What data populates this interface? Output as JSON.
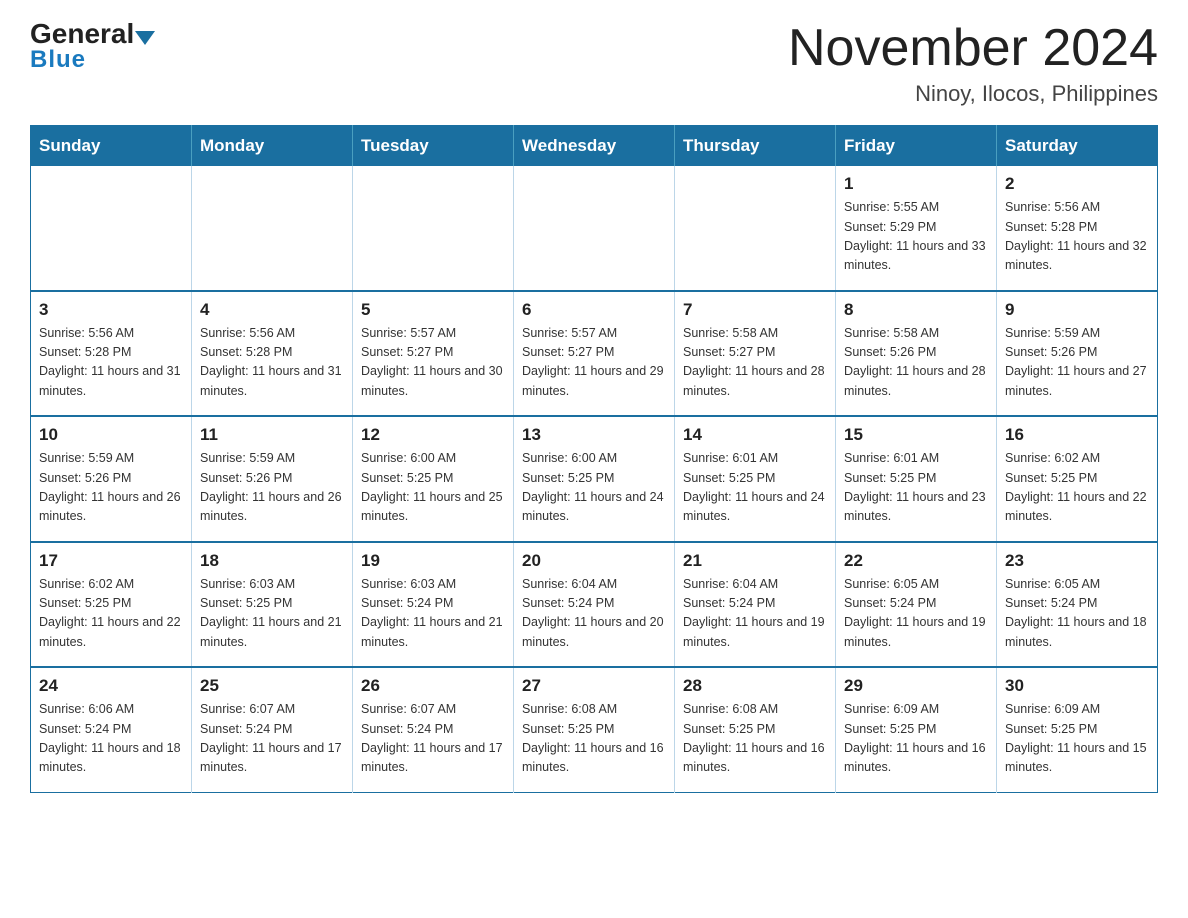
{
  "header": {
    "logo_line1": "General",
    "logo_line2": "Blue",
    "month_title": "November 2024",
    "location": "Ninoy, Ilocos, Philippines"
  },
  "calendar": {
    "weekdays": [
      "Sunday",
      "Monday",
      "Tuesday",
      "Wednesday",
      "Thursday",
      "Friday",
      "Saturday"
    ],
    "rows": [
      [
        {
          "day": "",
          "info": "",
          "empty": true
        },
        {
          "day": "",
          "info": "",
          "empty": true
        },
        {
          "day": "",
          "info": "",
          "empty": true
        },
        {
          "day": "",
          "info": "",
          "empty": true
        },
        {
          "day": "",
          "info": "",
          "empty": true
        },
        {
          "day": "1",
          "info": "Sunrise: 5:55 AM\nSunset: 5:29 PM\nDaylight: 11 hours and 33 minutes.",
          "empty": false
        },
        {
          "day": "2",
          "info": "Sunrise: 5:56 AM\nSunset: 5:28 PM\nDaylight: 11 hours and 32 minutes.",
          "empty": false
        }
      ],
      [
        {
          "day": "3",
          "info": "Sunrise: 5:56 AM\nSunset: 5:28 PM\nDaylight: 11 hours and 31 minutes.",
          "empty": false
        },
        {
          "day": "4",
          "info": "Sunrise: 5:56 AM\nSunset: 5:28 PM\nDaylight: 11 hours and 31 minutes.",
          "empty": false
        },
        {
          "day": "5",
          "info": "Sunrise: 5:57 AM\nSunset: 5:27 PM\nDaylight: 11 hours and 30 minutes.",
          "empty": false
        },
        {
          "day": "6",
          "info": "Sunrise: 5:57 AM\nSunset: 5:27 PM\nDaylight: 11 hours and 29 minutes.",
          "empty": false
        },
        {
          "day": "7",
          "info": "Sunrise: 5:58 AM\nSunset: 5:27 PM\nDaylight: 11 hours and 28 minutes.",
          "empty": false
        },
        {
          "day": "8",
          "info": "Sunrise: 5:58 AM\nSunset: 5:26 PM\nDaylight: 11 hours and 28 minutes.",
          "empty": false
        },
        {
          "day": "9",
          "info": "Sunrise: 5:59 AM\nSunset: 5:26 PM\nDaylight: 11 hours and 27 minutes.",
          "empty": false
        }
      ],
      [
        {
          "day": "10",
          "info": "Sunrise: 5:59 AM\nSunset: 5:26 PM\nDaylight: 11 hours and 26 minutes.",
          "empty": false
        },
        {
          "day": "11",
          "info": "Sunrise: 5:59 AM\nSunset: 5:26 PM\nDaylight: 11 hours and 26 minutes.",
          "empty": false
        },
        {
          "day": "12",
          "info": "Sunrise: 6:00 AM\nSunset: 5:25 PM\nDaylight: 11 hours and 25 minutes.",
          "empty": false
        },
        {
          "day": "13",
          "info": "Sunrise: 6:00 AM\nSunset: 5:25 PM\nDaylight: 11 hours and 24 minutes.",
          "empty": false
        },
        {
          "day": "14",
          "info": "Sunrise: 6:01 AM\nSunset: 5:25 PM\nDaylight: 11 hours and 24 minutes.",
          "empty": false
        },
        {
          "day": "15",
          "info": "Sunrise: 6:01 AM\nSunset: 5:25 PM\nDaylight: 11 hours and 23 minutes.",
          "empty": false
        },
        {
          "day": "16",
          "info": "Sunrise: 6:02 AM\nSunset: 5:25 PM\nDaylight: 11 hours and 22 minutes.",
          "empty": false
        }
      ],
      [
        {
          "day": "17",
          "info": "Sunrise: 6:02 AM\nSunset: 5:25 PM\nDaylight: 11 hours and 22 minutes.",
          "empty": false
        },
        {
          "day": "18",
          "info": "Sunrise: 6:03 AM\nSunset: 5:25 PM\nDaylight: 11 hours and 21 minutes.",
          "empty": false
        },
        {
          "day": "19",
          "info": "Sunrise: 6:03 AM\nSunset: 5:24 PM\nDaylight: 11 hours and 21 minutes.",
          "empty": false
        },
        {
          "day": "20",
          "info": "Sunrise: 6:04 AM\nSunset: 5:24 PM\nDaylight: 11 hours and 20 minutes.",
          "empty": false
        },
        {
          "day": "21",
          "info": "Sunrise: 6:04 AM\nSunset: 5:24 PM\nDaylight: 11 hours and 19 minutes.",
          "empty": false
        },
        {
          "day": "22",
          "info": "Sunrise: 6:05 AM\nSunset: 5:24 PM\nDaylight: 11 hours and 19 minutes.",
          "empty": false
        },
        {
          "day": "23",
          "info": "Sunrise: 6:05 AM\nSunset: 5:24 PM\nDaylight: 11 hours and 18 minutes.",
          "empty": false
        }
      ],
      [
        {
          "day": "24",
          "info": "Sunrise: 6:06 AM\nSunset: 5:24 PM\nDaylight: 11 hours and 18 minutes.",
          "empty": false
        },
        {
          "day": "25",
          "info": "Sunrise: 6:07 AM\nSunset: 5:24 PM\nDaylight: 11 hours and 17 minutes.",
          "empty": false
        },
        {
          "day": "26",
          "info": "Sunrise: 6:07 AM\nSunset: 5:24 PM\nDaylight: 11 hours and 17 minutes.",
          "empty": false
        },
        {
          "day": "27",
          "info": "Sunrise: 6:08 AM\nSunset: 5:25 PM\nDaylight: 11 hours and 16 minutes.",
          "empty": false
        },
        {
          "day": "28",
          "info": "Sunrise: 6:08 AM\nSunset: 5:25 PM\nDaylight: 11 hours and 16 minutes.",
          "empty": false
        },
        {
          "day": "29",
          "info": "Sunrise: 6:09 AM\nSunset: 5:25 PM\nDaylight: 11 hours and 16 minutes.",
          "empty": false
        },
        {
          "day": "30",
          "info": "Sunrise: 6:09 AM\nSunset: 5:25 PM\nDaylight: 11 hours and 15 minutes.",
          "empty": false
        }
      ]
    ]
  }
}
